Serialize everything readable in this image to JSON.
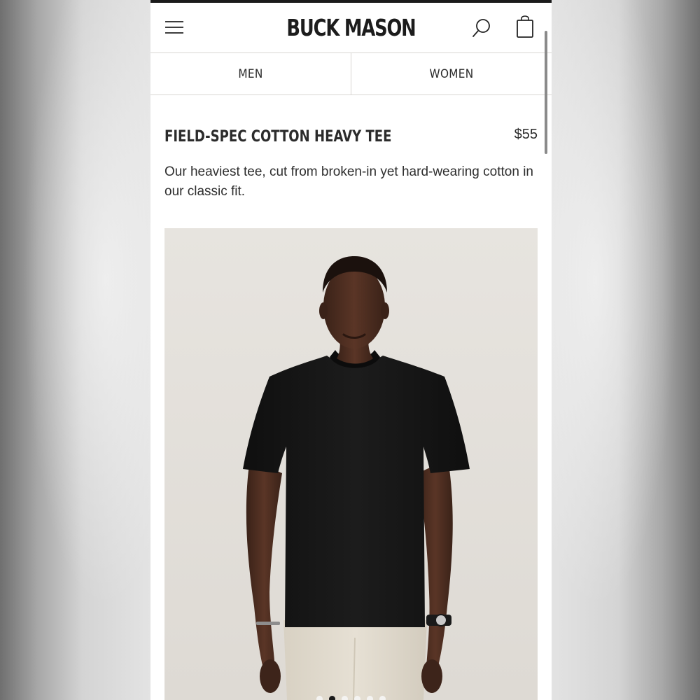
{
  "header": {
    "logo_text": "BUCK MASON",
    "menu_icon": "hamburger-menu-icon",
    "search_icon": "search-icon",
    "bag_icon": "shopping-bag-icon"
  },
  "nav": {
    "tabs": [
      {
        "label": "MEN"
      },
      {
        "label": "WOMEN"
      }
    ]
  },
  "product": {
    "title": "FIELD-SPEC COTTON HEAVY TEE",
    "price": "$55",
    "description": "Our heaviest tee, cut from broken-in yet hard-wearing cotton in our classic fit.",
    "image_subject": "model wearing black crew-neck tee with cream trousers",
    "carousel": {
      "dot_count": 6,
      "active_index": 1
    }
  },
  "colors": {
    "text": "#2b2b2b",
    "divider": "#d8d6d2",
    "image_bg": "#e6e3de",
    "tee": "#151515",
    "pants": "#e3ddd0",
    "skin": "#4a2c1f"
  }
}
